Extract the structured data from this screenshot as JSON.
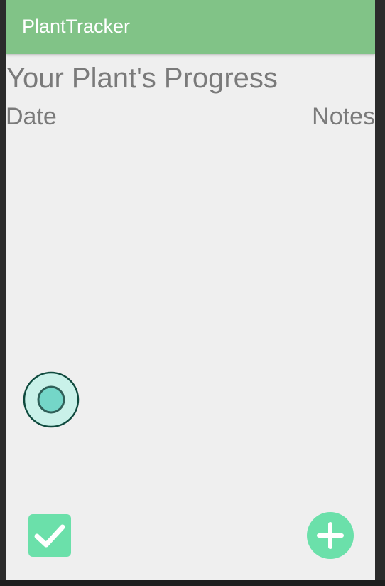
{
  "app": {
    "title": "PlantTracker"
  },
  "main": {
    "heading": "Your Plant's Progress",
    "columns": {
      "date": "Date",
      "notes": "Notes"
    },
    "entries": []
  },
  "controls": {
    "radio_selected": true,
    "checkbox_checked": true
  },
  "icons": {
    "radio": "radio-button-icon",
    "checkbox": "checkbox-checked-icon",
    "add": "add-icon"
  },
  "colors": {
    "appbar": "#81c387",
    "accent": "#6be0aa",
    "radio_fill": "#74d6c8",
    "radio_stroke": "#0f4a3e",
    "text_gray": "#7a7a7a",
    "background": "#efefef"
  }
}
